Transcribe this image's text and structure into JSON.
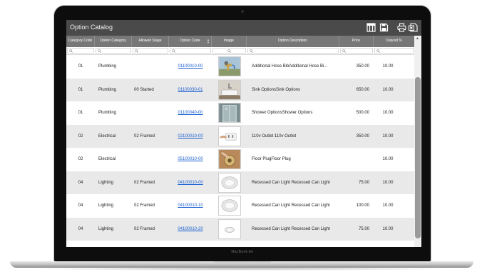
{
  "device_label": "MacBook Air",
  "app": {
    "title": "Option Catalog",
    "toolbar_icons": [
      "column-chooser-icon",
      "save-icon",
      "print-icon",
      "excel-export-icon"
    ]
  },
  "grid": {
    "headers": {
      "category_code": "Category Code",
      "option_category": "Option Category",
      "allowed_stage": "Allowed Stage",
      "option_code": "Option Code",
      "image": "Image",
      "option_description": "Option Description",
      "price": "Price",
      "deposit": "Deposit %"
    },
    "rows": [
      {
        "category_code": "01",
        "option_category": "Plumbing",
        "allowed_stage": "",
        "option_code": "01100010-00",
        "image": "hose-bib",
        "description": "Additional Hose BibAdditional Hose Bi...",
        "price": "350.00",
        "deposit": "10.00"
      },
      {
        "category_code": "01",
        "option_category": "Plumbing",
        "allowed_stage": "00 Started",
        "option_code": "01100030-01",
        "image": "sink",
        "description": "Sink OptionsSink Options",
        "price": "650.00",
        "deposit": "10.00"
      },
      {
        "category_code": "01",
        "option_category": "Plumbing",
        "allowed_stage": "",
        "option_code": "01100040-00",
        "image": "shower",
        "description": "Shower OptionsShower Options",
        "price": "500.00",
        "deposit": "10.00"
      },
      {
        "category_code": "02",
        "option_category": "Electrical",
        "allowed_stage": "02 Framed",
        "option_code": "02100010-00",
        "image": "outlet",
        "description": "110v Outlet 110v Outlet",
        "price": "350.00",
        "deposit": "10.00"
      },
      {
        "category_code": "02",
        "option_category": "Electrical",
        "allowed_stage": "",
        "option_code": "05100010-00",
        "image": "floor-plug",
        "description": "Floor PlugFloor Plug",
        "price": "",
        "deposit": "10.00"
      },
      {
        "category_code": "04",
        "option_category": "Lighting",
        "allowed_stage": "02 Framed",
        "option_code": "04100010-00",
        "image": "can-light",
        "description": "Recessed Can Light Recessed Can Light",
        "price": "75.00",
        "deposit": "10.00"
      },
      {
        "category_code": "04",
        "option_category": "Lighting",
        "allowed_stage": "02 Framed",
        "option_code": "04100010-10",
        "image": "can-light",
        "description": "Recessed Can Light Recessed Can Light",
        "price": "100.00",
        "deposit": "10.00"
      },
      {
        "category_code": "04",
        "option_category": "Lighting",
        "allowed_stage": "02 Framed",
        "option_code": "04100010-20",
        "image": "can-light-small",
        "description": "Recessed Can Light Recessed Can Light",
        "price": "75.00",
        "deposit": "10.00"
      }
    ]
  },
  "colors": {
    "titlebar": "#4a4a4a",
    "header": "#777777",
    "alt_row": "#e9e9e9",
    "link": "#1a5fd0"
  }
}
